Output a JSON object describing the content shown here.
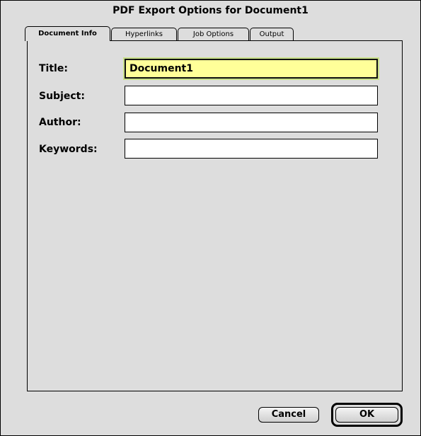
{
  "dialog": {
    "title": "PDF Export Options for Document1"
  },
  "tabs": [
    {
      "label": "Document Info",
      "active": true
    },
    {
      "label": "Hyperlinks",
      "active": false
    },
    {
      "label": "Job Options",
      "active": false
    },
    {
      "label": "Output",
      "active": false
    }
  ],
  "fields": {
    "title": {
      "label": "Title:",
      "value": "Document1"
    },
    "subject": {
      "label": "Subject:",
      "value": ""
    },
    "author": {
      "label": "Author:",
      "value": ""
    },
    "keywords": {
      "label": "Keywords:",
      "value": ""
    }
  },
  "buttons": {
    "cancel": "Cancel",
    "ok": "OK"
  },
  "colors": {
    "background": "#dddddd",
    "active_field": "#ffff99",
    "focus_ring": "#c9e08a"
  }
}
